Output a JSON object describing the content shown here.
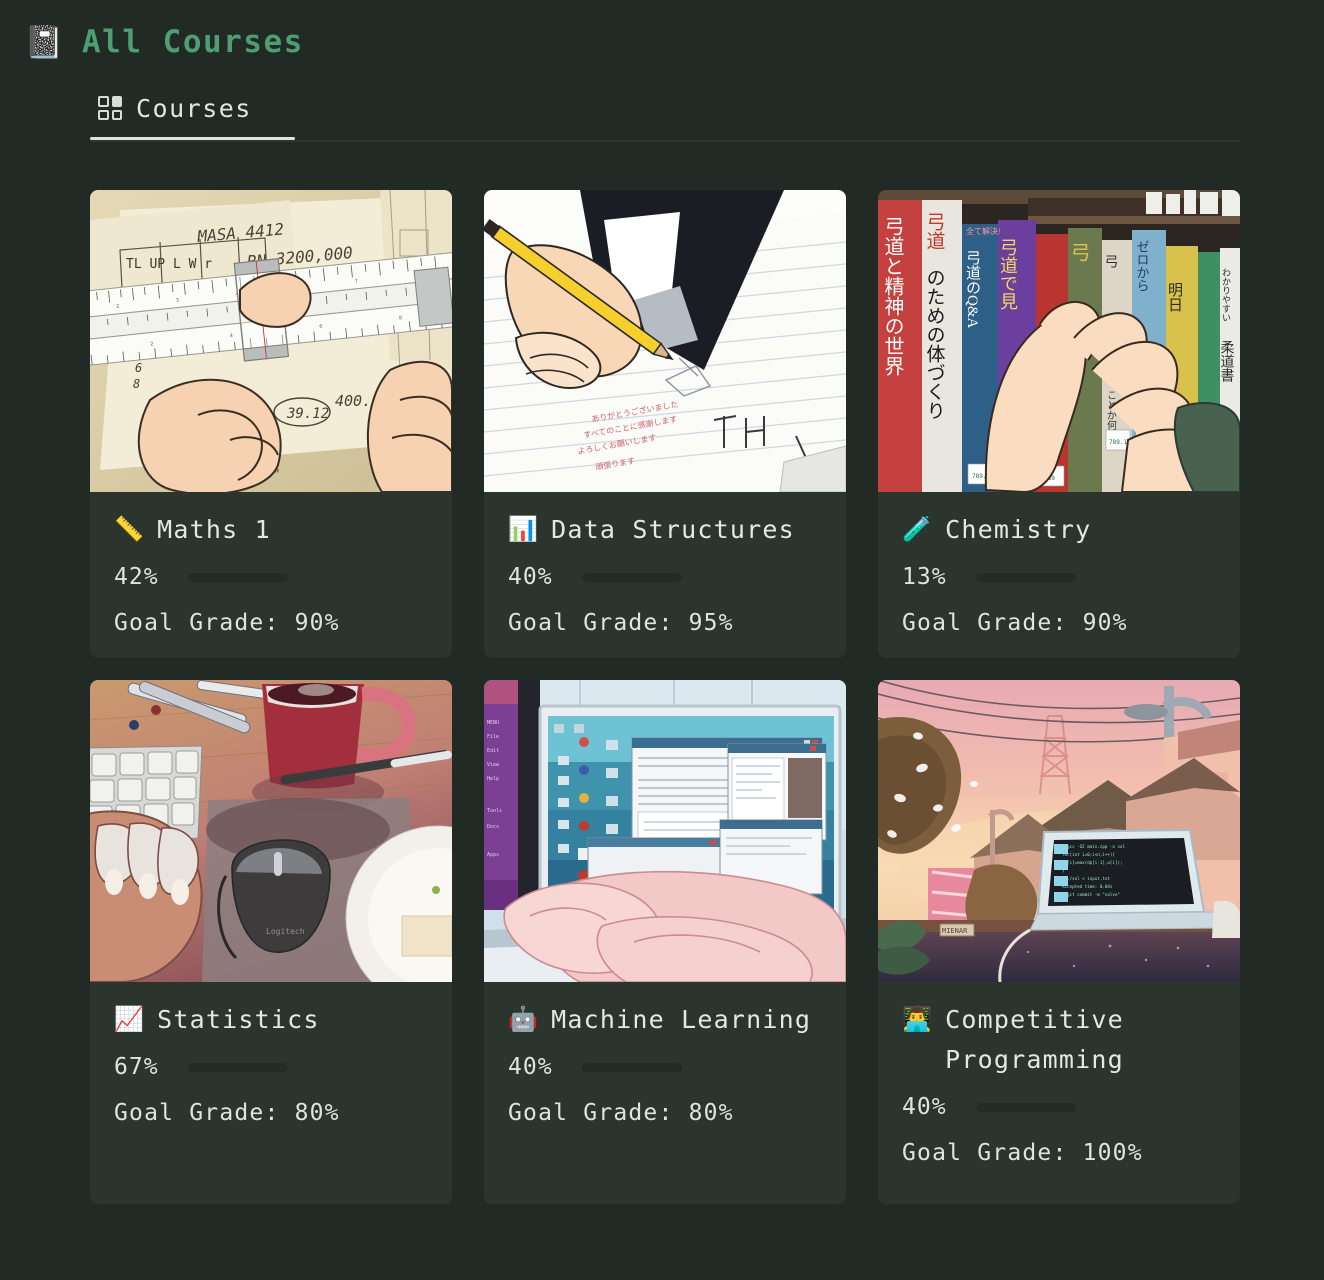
{
  "header": {
    "icon": "📓",
    "icon_name": "notebook-icon",
    "title": "All Courses",
    "title_color": "#4e9e72"
  },
  "tabs": [
    {
      "label": "Courses",
      "icon": "grid-icon",
      "active": true
    }
  ],
  "theme": {
    "background": "#212a24",
    "card_background": "#2b342d",
    "accent_green": "#4e9e72",
    "progress_fill": "#3f7d56",
    "progress_track": "#222c24",
    "text": "#e2e6e2"
  },
  "courses": [
    {
      "emoji": "📏",
      "emoji_name": "ruler-icon",
      "name": "Maths 1",
      "progress_label": "42%",
      "progress_value": 42,
      "goal_grade_label": "Goal Grade: 90%",
      "goal_grade": 90,
      "thumbnail": "slide-rule-engineering-notes"
    },
    {
      "emoji": "📊",
      "emoji_name": "bar-chart-icon",
      "name": "Data Structures",
      "progress_label": "40%",
      "progress_value": 40,
      "goal_grade_label": "Goal Grade: 95%",
      "goal_grade": 95,
      "thumbnail": "hand-writing-notebook-pencil"
    },
    {
      "emoji": "🧪",
      "emoji_name": "test-tube-icon",
      "name": "Chemistry",
      "progress_label": "13%",
      "progress_value": 13,
      "goal_grade_label": "Goal Grade: 90%",
      "goal_grade": 90,
      "thumbnail": "bookshelf-japanese-books-hands"
    },
    {
      "emoji": "📈",
      "emoji_name": "chart-increasing-icon",
      "name": "Statistics",
      "progress_label": "67%",
      "progress_value": 67,
      "goal_grade_label": "Goal Grade: 80%",
      "goal_grade": 80,
      "thumbnail": "desk-keyboard-mouse-mug"
    },
    {
      "emoji": "🤖",
      "emoji_name": "robot-icon",
      "name": "Machine Learning",
      "progress_label": "40%",
      "progress_value": 40,
      "goal_grade_label": "Goal Grade: 80%",
      "goal_grade": 80,
      "thumbnail": "hands-laptop-desktop-windows"
    },
    {
      "emoji": "👨‍💻",
      "emoji_name": "technologist-icon",
      "name": "Competitive Programming",
      "progress_label": "40%",
      "progress_value": 40,
      "goal_grade_label": "Goal Grade: 100%",
      "goal_grade": 100,
      "thumbnail": "sunset-laptop-terminal-rooftops"
    }
  ]
}
